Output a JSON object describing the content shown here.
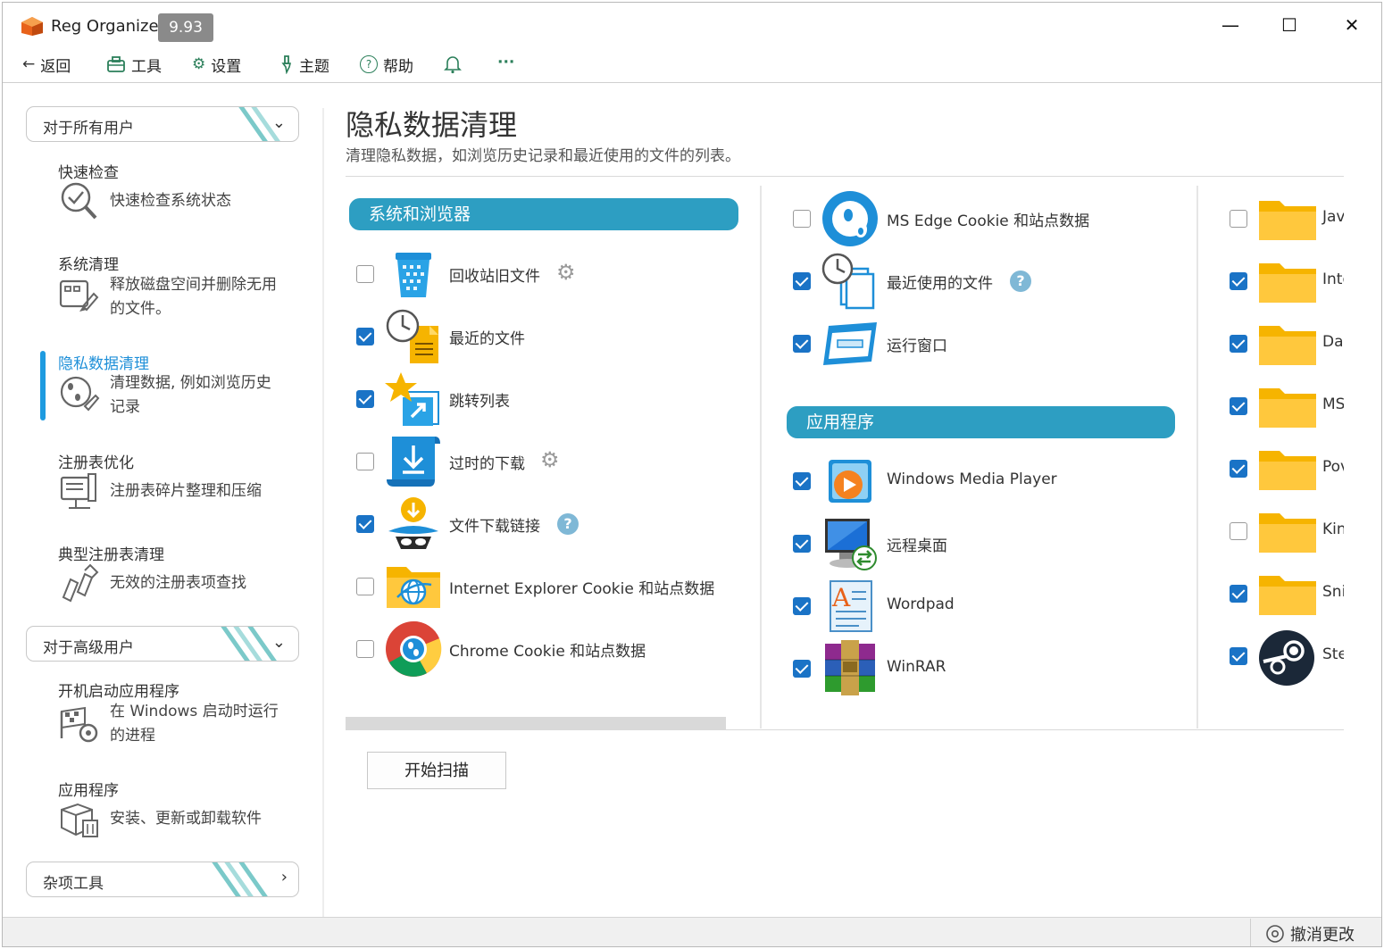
{
  "app": {
    "title": "Reg Organizer",
    "version": "9.93"
  },
  "window_controls": {
    "minimize": "—",
    "maximize": "☐",
    "close": "✕"
  },
  "menu": {
    "back": "返回",
    "tools": "工具",
    "settings": "设置",
    "theme": "主题",
    "help": "帮助",
    "more": "···"
  },
  "sidebar": {
    "group1": "对于所有用户",
    "group2": "对于高级用户",
    "group3": "杂项工具",
    "items": [
      {
        "title": "快速检查",
        "desc": "快速检查系统状态"
      },
      {
        "title": "系统清理",
        "desc": "释放磁盘空间并删除无用的文件。"
      },
      {
        "title": "隐私数据清理",
        "desc": "清理数据, 例如浏览历史记录"
      },
      {
        "title": "注册表优化",
        "desc": "注册表碎片整理和压缩"
      },
      {
        "title": "典型注册表清理",
        "desc": "无效的注册表项查找"
      },
      {
        "title": "开机启动应用程序",
        "desc": "在 Windows 启动时运行的进程"
      },
      {
        "title": "应用程序",
        "desc": "安装、更新或卸载软件"
      }
    ]
  },
  "main": {
    "title": "隐私数据清理",
    "subtitle": "清理隐私数据，如浏览历史记录和最近使用的文件的列表。",
    "section_system": "系统和浏览器",
    "section_apps": "应用程序",
    "col1": [
      {
        "label": "回收站旧文件",
        "checked": false,
        "extra": "gear"
      },
      {
        "label": "最近的文件",
        "checked": true,
        "extra": ""
      },
      {
        "label": "跳转列表",
        "checked": true,
        "extra": ""
      },
      {
        "label": "过时的下载",
        "checked": false,
        "extra": "gear"
      },
      {
        "label": "文件下载链接",
        "checked": true,
        "extra": "help"
      },
      {
        "label": "Internet Explorer Cookie 和站点数据",
        "checked": false,
        "extra": ""
      },
      {
        "label": "Chrome Cookie 和站点数据",
        "checked": false,
        "extra": ""
      }
    ],
    "col2_top": [
      {
        "label": "MS Edge Cookie 和站点数据",
        "checked": false,
        "extra": ""
      },
      {
        "label": "最近使用的文件",
        "checked": true,
        "extra": "help"
      },
      {
        "label": "运行窗口",
        "checked": true,
        "extra": ""
      }
    ],
    "col2_apps": [
      {
        "label": "Windows Media Player",
        "checked": true
      },
      {
        "label": "远程桌面",
        "checked": true
      },
      {
        "label": "Wordpad",
        "checked": true
      },
      {
        "label": "WinRAR",
        "checked": true
      }
    ],
    "col3": [
      {
        "label": "Jav",
        "checked": false
      },
      {
        "label": "Inte",
        "checked": true
      },
      {
        "label": "Da",
        "checked": true
      },
      {
        "label": "MS",
        "checked": true
      },
      {
        "label": "Pov",
        "checked": true
      },
      {
        "label": "Kin",
        "checked": false
      },
      {
        "label": "Sni",
        "checked": true
      },
      {
        "label": "Ste",
        "checked": true
      }
    ],
    "scan_button": "开始扫描"
  },
  "status": {
    "undo": "撤消更改"
  },
  "colors": {
    "accent": "#2d9ec2",
    "checkbox": "#1a73c6",
    "active_bar": "#1e9be0",
    "folder": "#ffc83d"
  }
}
